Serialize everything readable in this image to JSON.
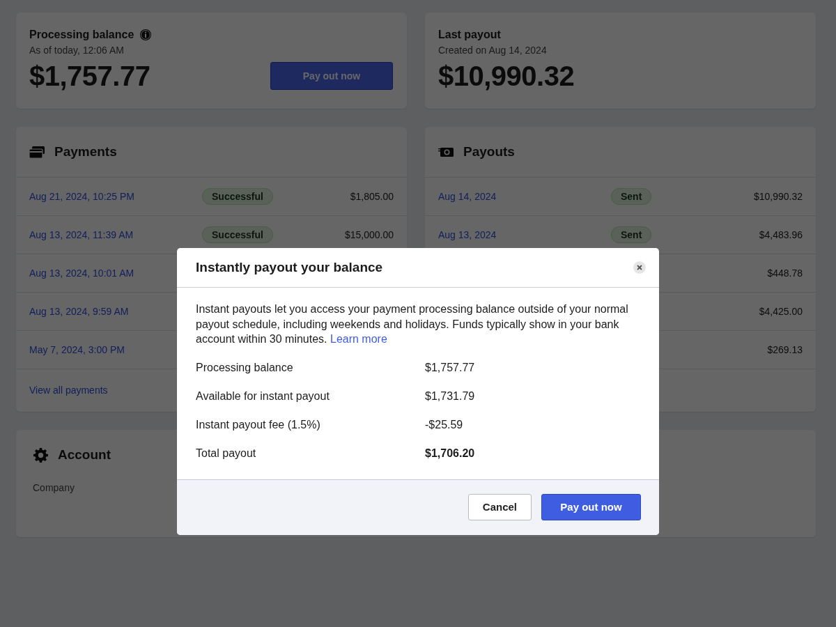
{
  "processing_balance": {
    "title": "Processing balance",
    "subtitle": "As of today, 12:06 AM",
    "amount": "$1,757.77",
    "button": "Pay out now"
  },
  "last_payout": {
    "title": "Last payout",
    "subtitle": "Created on Aug 14, 2024",
    "amount": "$10,990.32"
  },
  "payments": {
    "title": "Payments",
    "rows": [
      {
        "date": "Aug 21, 2024, 10:25 PM",
        "status": "Successful",
        "amount": "$1,805.00"
      },
      {
        "date": "Aug 13, 2024, 11:39 AM",
        "status": "Successful",
        "amount": "$15,000.00"
      },
      {
        "date": "Aug 13, 2024, 10:01 AM"
      },
      {
        "date": "Aug 13, 2024, 9:59 AM"
      },
      {
        "date": "May 7, 2024, 3:00 PM"
      }
    ],
    "footer_link": "View all payments"
  },
  "payouts": {
    "title": "Payouts",
    "rows": [
      {
        "date": "Aug 14, 2024",
        "status": "Sent",
        "amount": "$10,990.32"
      },
      {
        "date": "Aug 13, 2024",
        "status": "Sent",
        "amount": "$4,483.96"
      },
      {
        "amount": "$448.78"
      },
      {
        "amount": "$4,425.00"
      },
      {
        "amount": "$269.13"
      }
    ]
  },
  "account": {
    "title": "Account",
    "label": "Company"
  },
  "modal": {
    "title": "Instantly payout your balance",
    "description": "Instant payouts let you access your payment processing balance outside of your normal payout schedule, including weekends and holidays. Funds typically show in your bank account within 30 minutes.",
    "link": "Learn more",
    "lines": [
      {
        "label": "Processing balance",
        "value": "$1,757.77",
        "emphasis": false
      },
      {
        "label": "Available for instant payout",
        "value": "$1,731.79",
        "emphasis": false
      },
      {
        "label": "Instant payout fee (1.5%)",
        "value": "-$25.59",
        "emphasis": false
      },
      {
        "label": "Total payout",
        "value": "$1,706.20",
        "emphasis": true
      }
    ],
    "buttons": [
      {
        "label": "Cancel",
        "kind": "secondary"
      },
      {
        "label": "Pay out now",
        "kind": "primary"
      }
    ]
  }
}
